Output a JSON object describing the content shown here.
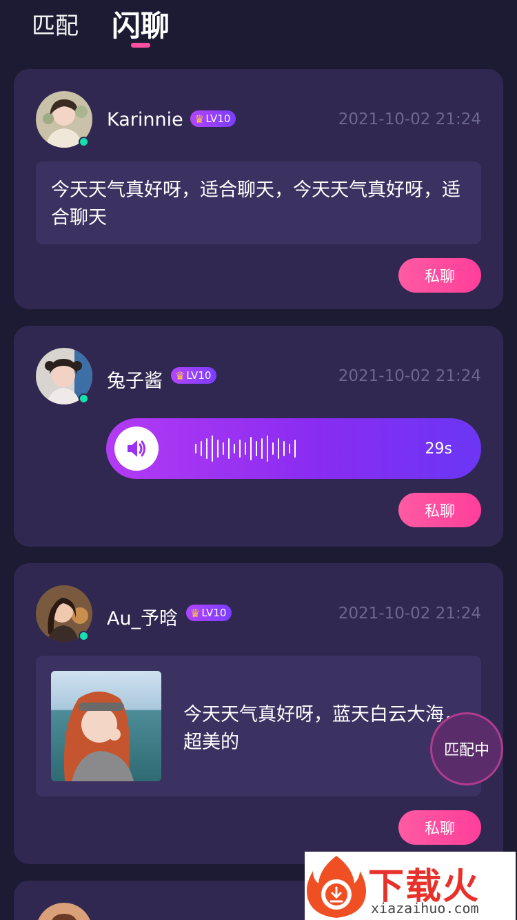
{
  "tabs": {
    "match_label": "匹配",
    "flash_label": "闪聊"
  },
  "posts": [
    {
      "username": "Karinnie",
      "level": "LV10",
      "time": "2021-10-02 21:24",
      "type": "text",
      "text": "今天天气真好呀，适合聊天，今天天气真好呀，适合聊天",
      "button": "私聊"
    },
    {
      "username": "兔子酱",
      "level": "LV10",
      "time": "2021-10-02 21:24",
      "type": "voice",
      "duration": "29s",
      "button": "私聊"
    },
    {
      "username": "Au_予晗",
      "level": "LV10",
      "time": "2021-10-02 21:24",
      "type": "image",
      "text": "今天天气真好呀，蓝天白云大海，超美的",
      "button": "私聊"
    }
  ],
  "floating": {
    "matching_label": "匹配中"
  },
  "watermark": {
    "title": "下载火",
    "url": "xiazaihuo.com"
  },
  "colors": {
    "background": "#1d1b33",
    "card": "#302850",
    "accent_pink": "#ff4fa3",
    "online": "#16e0b0"
  }
}
